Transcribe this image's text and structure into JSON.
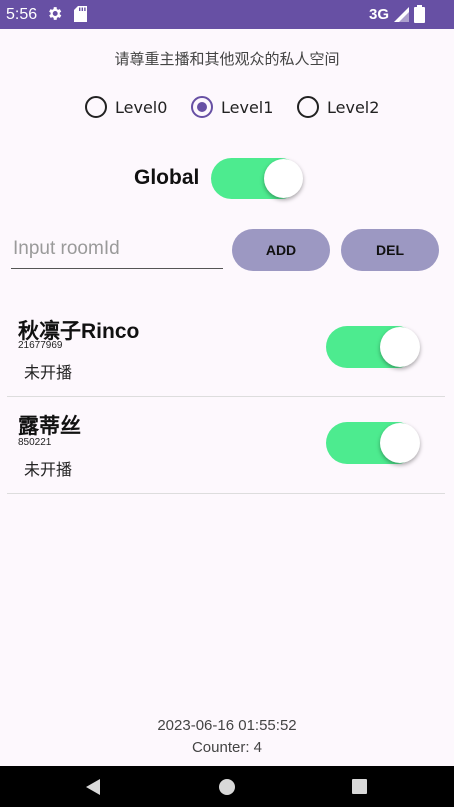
{
  "status_bar": {
    "time": "5:56",
    "network": "3G",
    "icons": [
      "gear-icon",
      "sd-card-icon",
      "signal-icon",
      "battery-icon"
    ],
    "background": "#6750a4"
  },
  "notice": "请尊重主播和其他观众的私人空间",
  "levels": {
    "options": [
      "Level0",
      "Level1",
      "Level2"
    ],
    "selected": "Level1"
  },
  "global": {
    "label": "Global",
    "enabled": true
  },
  "room_input": {
    "placeholder": "Input roomId",
    "value": ""
  },
  "buttons": {
    "add": "ADD",
    "del": "DEL"
  },
  "rooms": [
    {
      "name": "秋凛子Rinco",
      "id": "21677969",
      "status": "未开播",
      "enabled": true
    },
    {
      "name": "露蒂丝",
      "id": "850221",
      "status": "未开播",
      "enabled": true
    }
  ],
  "footer": {
    "datetime": "2023-06-16 01:55:52",
    "counter": "Counter: 4"
  },
  "nav": {
    "icons": [
      "back-icon",
      "home-icon",
      "recent-apps-icon"
    ]
  },
  "colors": {
    "accent": "#6750a4",
    "switch_on": "#4deb8f",
    "button": "#9c98c2"
  }
}
